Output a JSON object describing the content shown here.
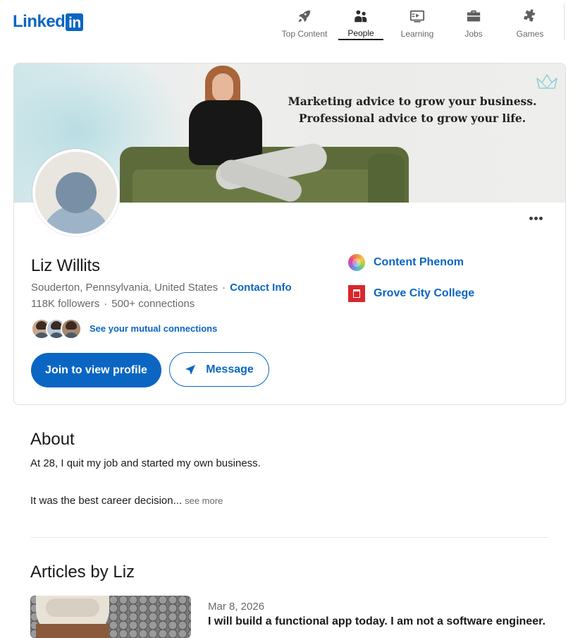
{
  "header": {
    "logo_text": "Linked",
    "logo_badge": "in",
    "nav": [
      {
        "label": "Top Content",
        "icon": "rocket-icon",
        "active": false
      },
      {
        "label": "People",
        "icon": "people-icon",
        "active": true
      },
      {
        "label": "Learning",
        "icon": "video-icon",
        "active": false
      },
      {
        "label": "Jobs",
        "icon": "briefcase-icon",
        "active": false
      },
      {
        "label": "Games",
        "icon": "puzzle-icon",
        "active": false
      }
    ]
  },
  "profile": {
    "banner_line1": "Marketing advice to grow your business.",
    "banner_line2": "Professional advice to grow your life.",
    "name": "Liz Willits",
    "location": "Souderton, Pennsylvania, United States",
    "contact_label": "Contact Info",
    "followers": "118K followers",
    "connections": "500+ connections",
    "mutual_label": "See your mutual connections",
    "join_label": "Join to view profile",
    "message_label": "Message",
    "companies": [
      {
        "name": "Content Phenom",
        "icon": "content-phenom-logo"
      },
      {
        "name": "Grove City College",
        "icon": "grove-city-college-logo"
      }
    ]
  },
  "about": {
    "title": "About",
    "line1": "At 28, I quit my job and started my own business.",
    "line2": "It was the best career decision...",
    "see_more": "see more"
  },
  "articles": {
    "title": "Articles by Liz",
    "items": [
      {
        "date": "Mar 8, 2026",
        "title": "I will build a functional app today. I am not a software engineer."
      }
    ]
  },
  "colors": {
    "brand_blue": "#0a66c2",
    "text_primary": "rgba(0,0,0,0.9)",
    "text_secondary": "rgba(0,0,0,0.6)"
  }
}
